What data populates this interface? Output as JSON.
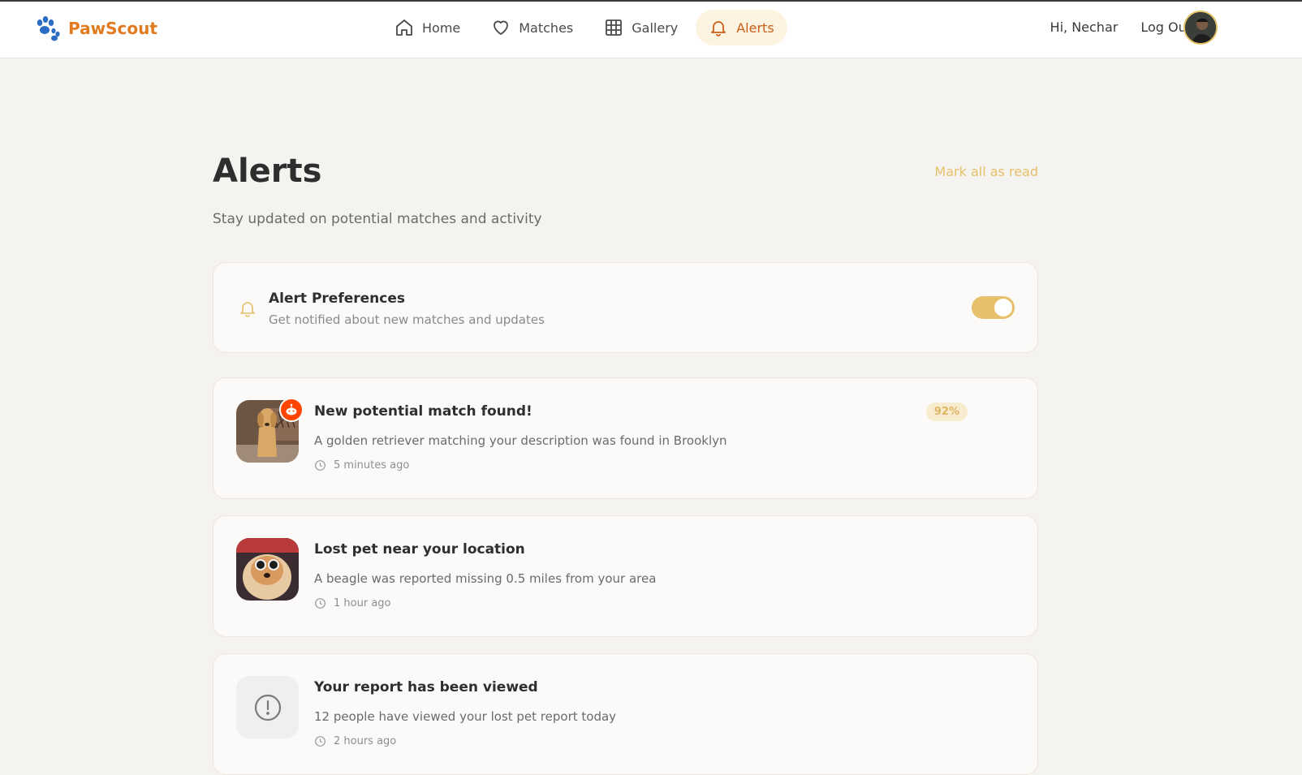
{
  "brand": {
    "name": "PawScout"
  },
  "nav": {
    "items": [
      {
        "label": "Home",
        "icon": "home-icon"
      },
      {
        "label": "Matches",
        "icon": "heart-icon"
      },
      {
        "label": "Gallery",
        "icon": "grid-icon"
      },
      {
        "label": "Alerts",
        "icon": "bell-icon",
        "active": true
      }
    ],
    "greeting": "Hi, Nechar",
    "logout": "Log Out"
  },
  "page": {
    "title": "Alerts",
    "subtitle": "Stay updated on potential matches and activity",
    "mark_all": "Mark all as read"
  },
  "preferences": {
    "title": "Alert Preferences",
    "description": "Get notified about new matches and updates",
    "enabled": true
  },
  "alerts": [
    {
      "title": "New potential match found!",
      "description": "A golden retriever matching your description was found in Brooklyn",
      "time": "5 minutes ago",
      "match": "92%"
    },
    {
      "title": "Lost pet near your location",
      "description": "A beagle was reported missing 0.5 miles from your area",
      "time": "1 hour ago"
    },
    {
      "title": "Your report has been viewed",
      "description": "12 people have viewed your lost pet report today",
      "time": "2 hours ago"
    }
  ],
  "colors": {
    "brand": "#e07b1f",
    "accent": "#e6c06a",
    "active_nav_bg": "#fdf3e1",
    "background": "#f5f3ef"
  }
}
